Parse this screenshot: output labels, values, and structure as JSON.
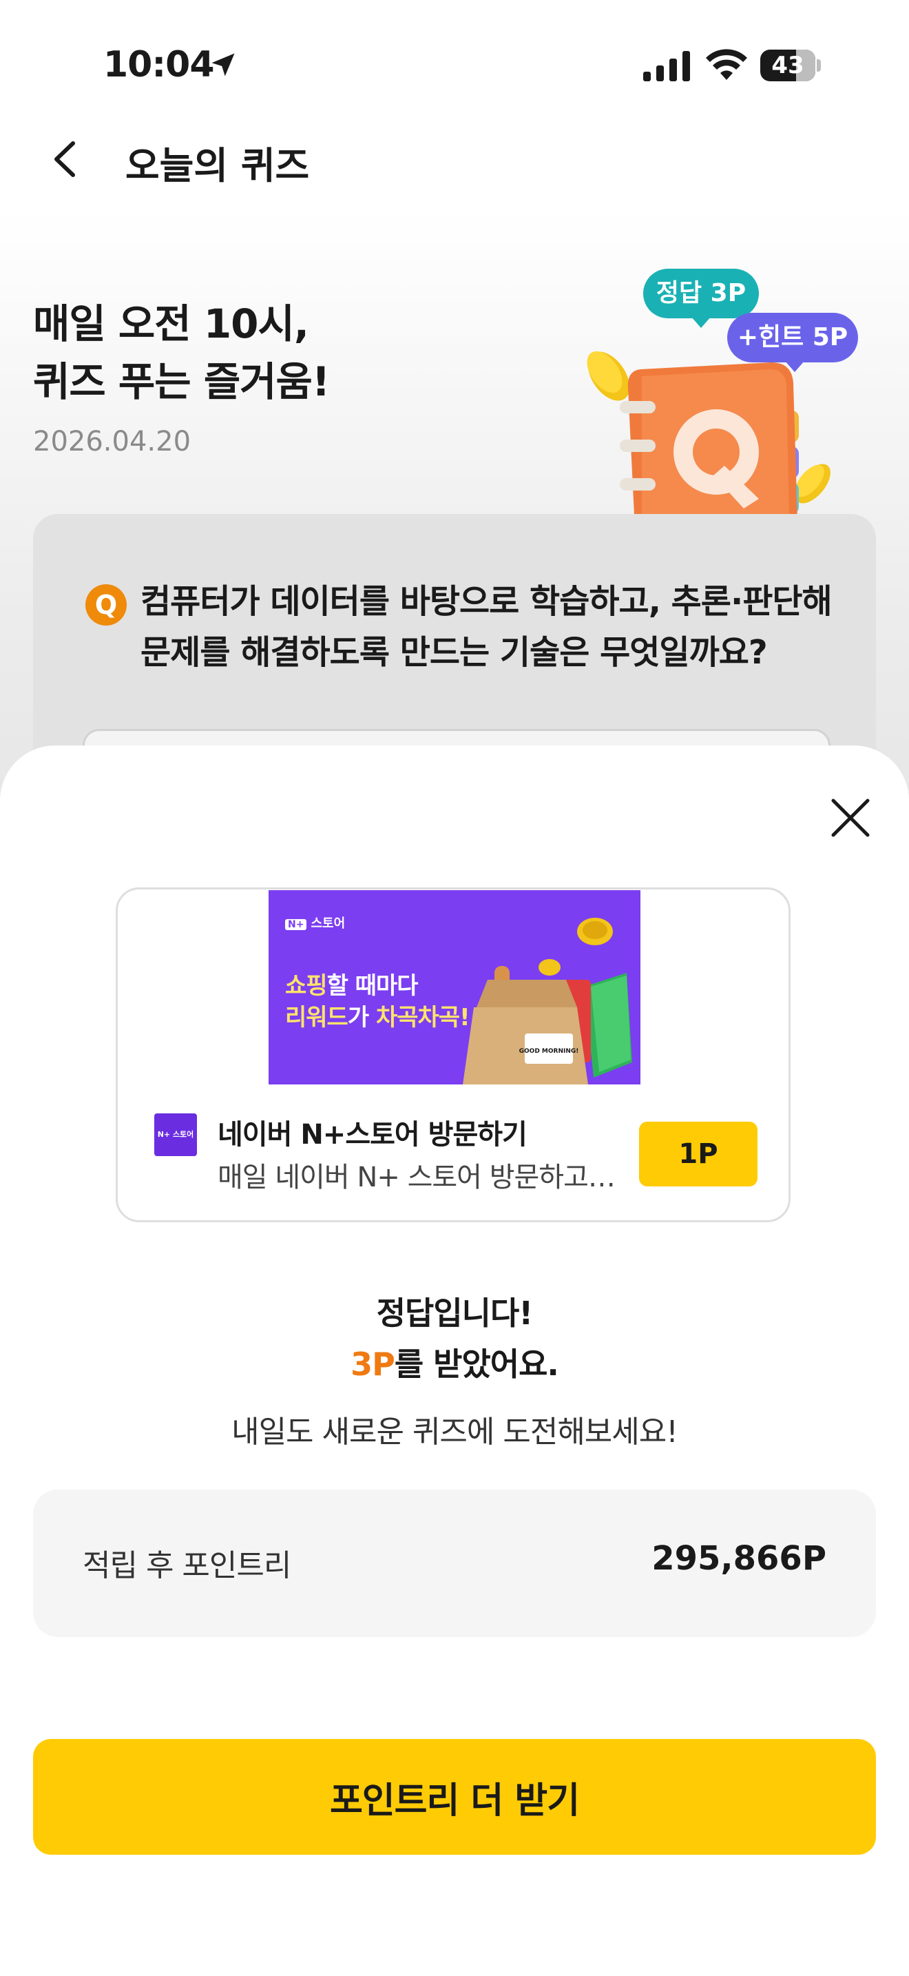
{
  "status_bar": {
    "time": "10:04",
    "battery": "43",
    "icons": [
      "location-arrow-icon",
      "cellular-signal-icon",
      "wifi-icon",
      "battery-icon"
    ]
  },
  "header": {
    "title": "오늘의 퀴즈",
    "back_icon": "chevron-left-icon"
  },
  "hero": {
    "title_line1": "매일 오전 10시,",
    "title_line2": "퀴즈 푸는 즐거움!",
    "date": "2026.04.20",
    "bubble_answer": "정답 3P",
    "bubble_hint": "+힌트 5P"
  },
  "question": {
    "badge": "Q",
    "text": "컴퓨터가 데이터를 바탕으로 학습하고, 추론·판단해 문제를 해결하도록 만드는 기술은 무엇일까요?"
  },
  "sheet": {
    "close_icon": "close-icon",
    "ad": {
      "banner_brand": "스토어",
      "banner_line1_highlight": "쇼핑",
      "banner_line1_rest": "할 때마다",
      "banner_line2_highlight": "리워드",
      "banner_line2_mid": "가 ",
      "banner_line2_end": "차곡차곡!",
      "banner_bag_label": "GOOD MORNING!",
      "thumb_label": "N+ 스토어",
      "title": "네이버 N+스토어 방문하기",
      "description": "매일 네이버 N+ 스토어 방문하고 포인트 받기",
      "point_button": "1P"
    },
    "result": {
      "line1": "정답입니다!",
      "points": "3P",
      "line2_rest": "를 받았어요.",
      "sub": "내일도 새로운 퀴즈에 도전해보세요!"
    },
    "balance": {
      "label": "적립 후 포인트리",
      "value": "295,866P"
    },
    "cta_label": "포인트리 더 받기"
  },
  "colors": {
    "accent_yellow": "#ffcb05",
    "answer_bubble": "#1ab1b4",
    "hint_bubble": "#6a63ea",
    "point_orange": "#f07a11",
    "banner_purple": "#7b3ef0"
  }
}
